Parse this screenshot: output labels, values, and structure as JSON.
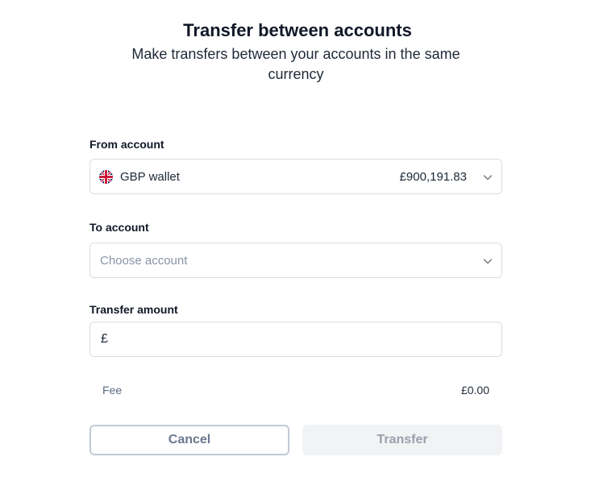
{
  "header": {
    "title": "Transfer between accounts",
    "subtitle": "Make transfers between your accounts in the same currency"
  },
  "from_account": {
    "label": "From account",
    "selected_name": "GBP wallet",
    "selected_balance": "£900,191.83",
    "flag": "uk-flag-icon"
  },
  "to_account": {
    "label": "To account",
    "placeholder": "Choose account"
  },
  "transfer_amount": {
    "label": "Transfer amount",
    "currency_symbol": "£",
    "value": ""
  },
  "fee": {
    "label": "Fee",
    "value": "£0.00"
  },
  "actions": {
    "cancel_label": "Cancel",
    "transfer_label": "Transfer"
  },
  "colors": {
    "border": "#d9dde5",
    "muted_text": "#8a93a6",
    "disabled_button_bg": "#f2f3f5"
  }
}
